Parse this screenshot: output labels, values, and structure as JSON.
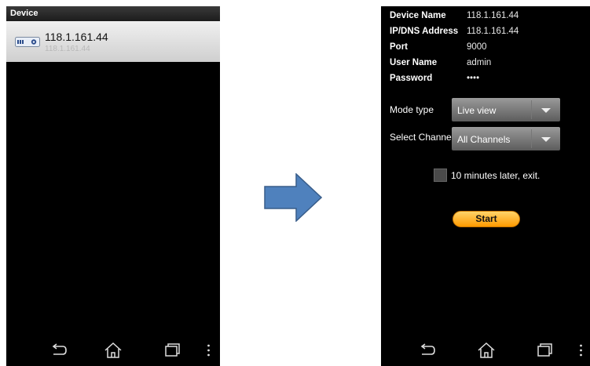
{
  "left_screen": {
    "title": "Device",
    "device": {
      "name": "118.1.161.44",
      "ip": "118.1.161.44"
    }
  },
  "right_screen": {
    "info": [
      {
        "label": "Device Name",
        "value": "118.1.161.44"
      },
      {
        "label": "IP/DNS Address",
        "value": "118.1.161.44"
      },
      {
        "label": "Port",
        "value": "9000"
      },
      {
        "label": "User Name",
        "value": "admin"
      },
      {
        "label": "Password",
        "value": "••••"
      }
    ],
    "mode_type": {
      "label": "Mode type",
      "value": "Live view"
    },
    "select_channel": {
      "label": "Select Channel(s)",
      "value": "All Channels"
    },
    "exit_option": {
      "label": "10 minutes later, exit.",
      "checked": false
    },
    "start_label": "Start"
  },
  "colors": {
    "arrow": "#4f81bd",
    "start_button": "#ffa500",
    "device_item_bg": "#d9d9d9"
  },
  "icons": [
    "dvr-device-icon",
    "back-icon",
    "home-icon",
    "recent-apps-icon",
    "menu-icon",
    "right-arrow-icon"
  ]
}
